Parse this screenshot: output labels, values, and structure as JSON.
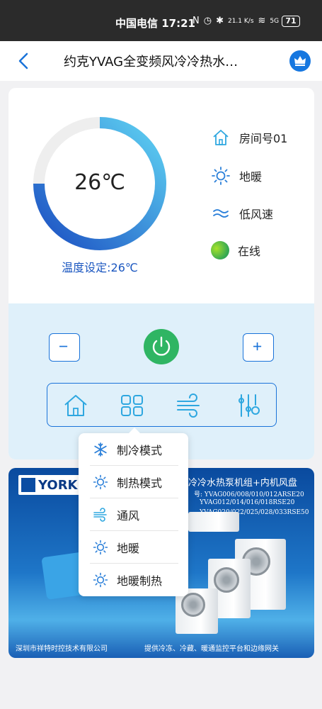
{
  "status_bar": {
    "carrier_time": "中国电信 17:21",
    "network_speed": "21.1 K/s",
    "signal": "5G",
    "battery": "71"
  },
  "header": {
    "title": "约克YVAG全变频风冷冷热水…",
    "icons": {
      "back": "chevron-left-icon",
      "vip": "crown-icon"
    }
  },
  "thermostat": {
    "temperature": "26℃",
    "setting": "温度设定:26℃",
    "gauge_fraction": 0.75,
    "colors": {
      "arc_start": "#1b4fc2",
      "arc_end": "#5fd3f3",
      "track": "#eeeeee"
    }
  },
  "info": {
    "room": "房间号01",
    "mode": "地暖",
    "fan_speed": "低风速",
    "status": "在线"
  },
  "controls": {
    "minus": "−",
    "plus": "+",
    "tabs": [
      "home-icon",
      "grid-icon",
      "wind-icon",
      "sliders-icon"
    ]
  },
  "mode_menu": {
    "items": [
      {
        "label": "制冷模式",
        "icon": "snowflake-icon"
      },
      {
        "label": "制热模式",
        "icon": "sun-icon"
      },
      {
        "label": "通风",
        "icon": "wind-icon"
      },
      {
        "label": "地暖",
        "icon": "sun-icon"
      },
      {
        "label": "地暖制热",
        "icon": "sun-icon"
      }
    ]
  },
  "banner": {
    "brand": "YORK",
    "title": "冷冷水热泵机组+内机风盘",
    "models": [
      "号: YVAG006/008/010/012ARSE20",
      "YVAG012/014/016/018RSE20",
      "YVAG020/022/025/028/033RSE50"
    ],
    "footer_left": "深圳市祥特时控技术有限公司",
    "footer_right": "提供冷冻、冷藏、暖通监控平台和边缘网关"
  }
}
